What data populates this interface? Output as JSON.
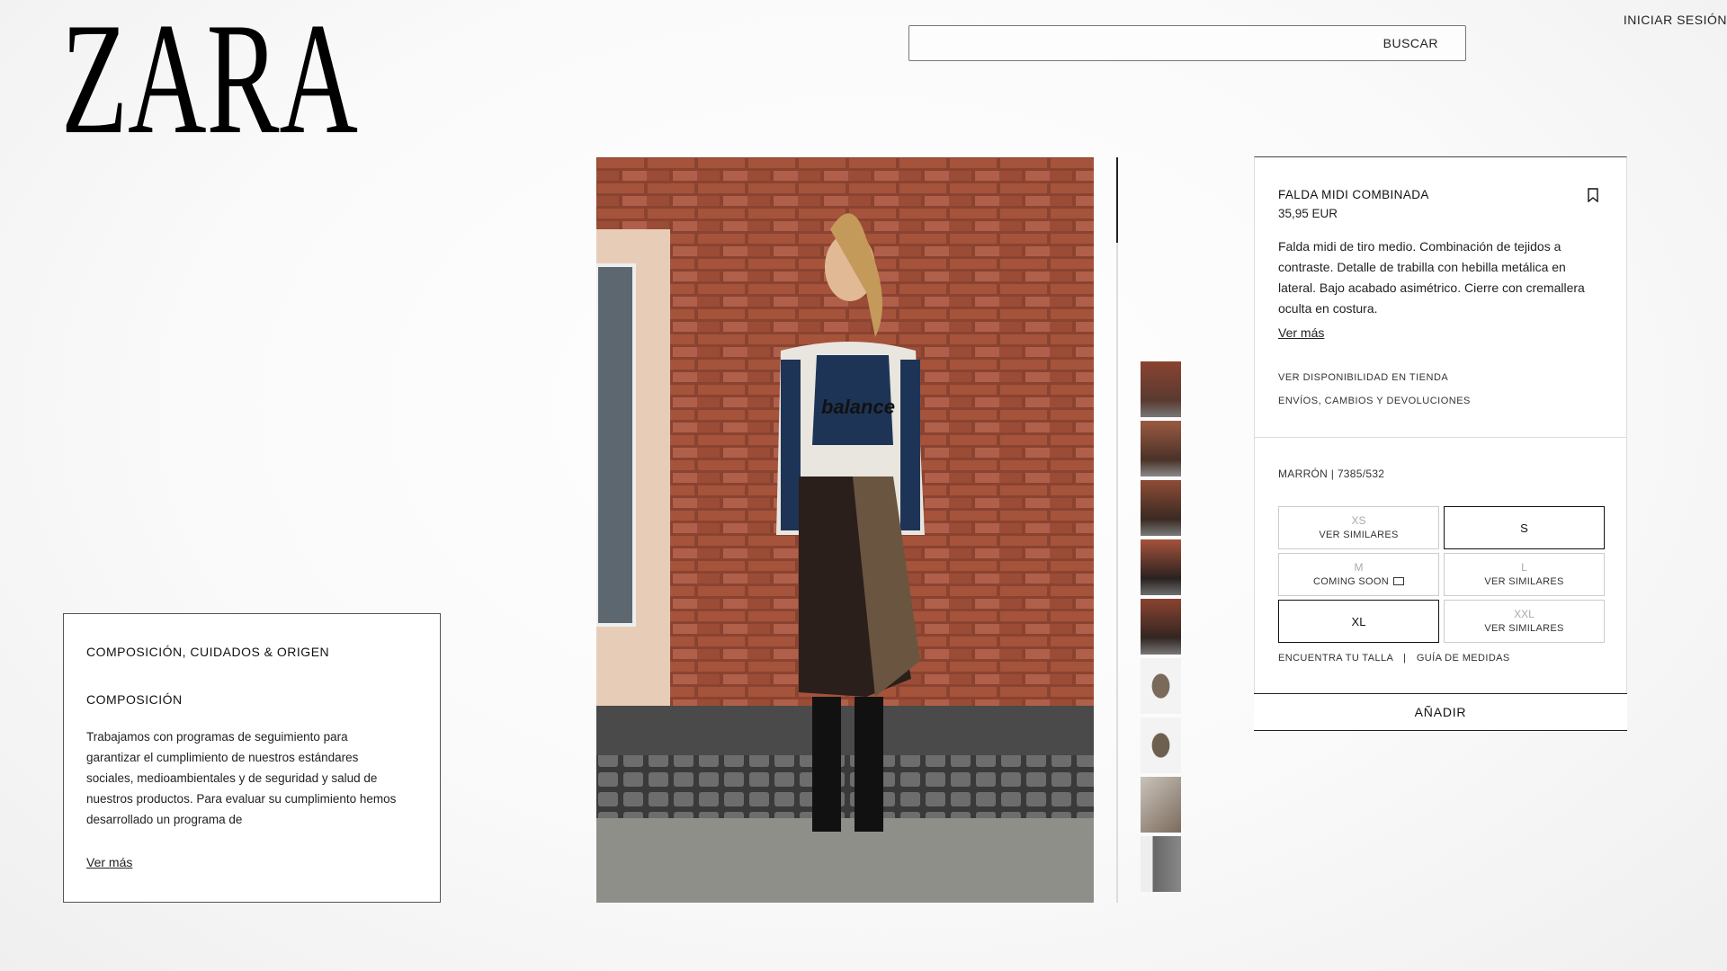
{
  "header": {
    "logo_text": "ZARA",
    "search_label": "BUSCAR",
    "login_label": "INICIAR SESIÓN"
  },
  "info_box": {
    "heading": "COMPOSICIÓN, CUIDADOS & ORIGEN",
    "subheading": "COMPOSICIÓN",
    "text": "Trabajamos con programas de seguimiento para garantizar el cumplimiento de nuestros estándares sociales, medioambientales y de seguridad y salud de nuestros productos. Para evaluar su cumplimiento hemos desarrollado un programa de",
    "more_link": "Ver más"
  },
  "product": {
    "title": "FALDA MIDI COMBINADA",
    "price": "35,95 EUR",
    "description": "Falda midi de tiro medio. Combinación de tejidos a contraste. Detalle de trabilla con hebilla metálica en lateral. Bajo acabado asimétrico. Cierre con cremallera oculta en costura.",
    "more_link": "Ver más",
    "link_store": "VER DISPONIBILIDAD EN TIENDA",
    "link_shipping": "ENVÍOS, CAMBIOS Y DEVOLUCIONES",
    "color_ref": "MARRÓN | 7385/532",
    "sizes": [
      {
        "name": "XS",
        "note": "VER SIMILARES"
      },
      {
        "name": "S",
        "note": ""
      },
      {
        "name": "M",
        "note": "COMING SOON"
      },
      {
        "name": "L",
        "note": "VER SIMILARES"
      },
      {
        "name": "XL",
        "note": ""
      },
      {
        "name": "XXL",
        "note": "VER SIMILARES"
      }
    ],
    "find_size": "ENCUENTRA TU TALLA",
    "separator": "|",
    "size_guide": "GUÍA DE MEDIDAS",
    "add_button": "AÑADIR"
  },
  "photo_graphic": {
    "shirt_text": "balance"
  }
}
